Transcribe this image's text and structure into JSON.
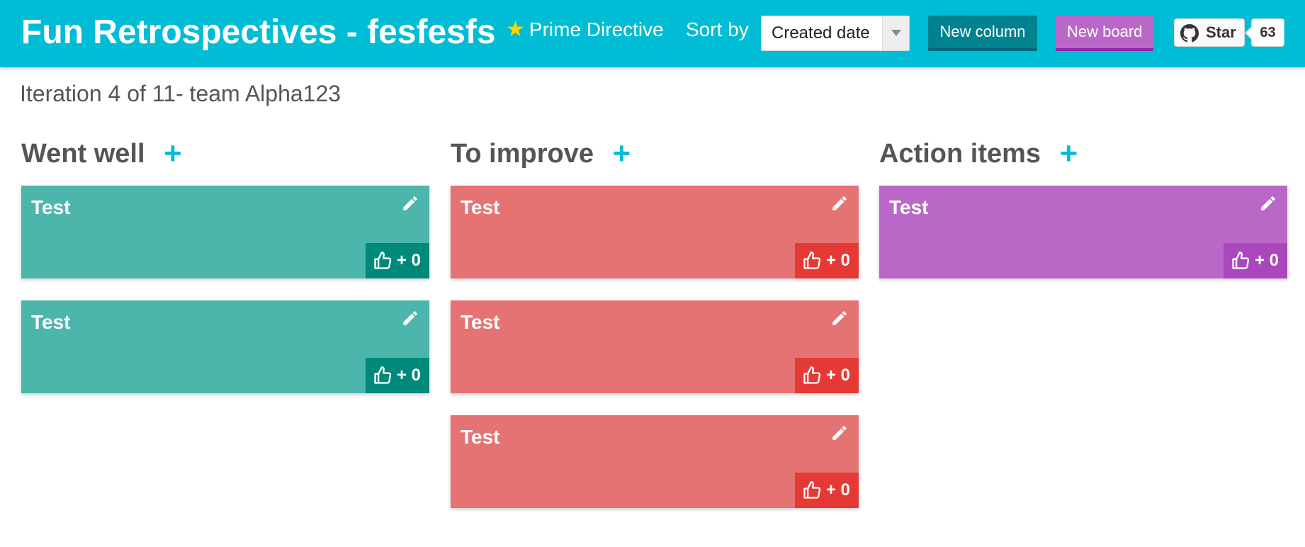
{
  "header": {
    "title": "Fun Retrospectives - fesfesfs",
    "prime_directive_label": "Prime Directive",
    "sort_label": "Sort by",
    "sort_value": "Created date",
    "new_column_label": "New column",
    "new_board_label": "New board",
    "github_star_label": "Star",
    "github_star_count": "63",
    "colors": {
      "bar": "#00bcd4",
      "new_column": "#00838f",
      "new_board": "#ba68c8",
      "star_icon": "#ffd600"
    }
  },
  "board": {
    "subtitle": "Iteration 4 of 11- team Alpha123"
  },
  "columns": [
    {
      "title": "Went well",
      "add_symbol": "+",
      "color": "#4db6ac",
      "vote_color": "#00897b",
      "cards": [
        {
          "text": "Test",
          "votes": "+ 0"
        },
        {
          "text": "Test",
          "votes": "+ 0"
        }
      ]
    },
    {
      "title": "To improve",
      "add_symbol": "+",
      "color": "#e57373",
      "vote_color": "#e53935",
      "cards": [
        {
          "text": "Test",
          "votes": "+ 0"
        },
        {
          "text": "Test",
          "votes": "+ 0"
        },
        {
          "text": "Test",
          "votes": "+ 0"
        }
      ]
    },
    {
      "title": "Action items",
      "add_symbol": "+",
      "color": "#ba68c8",
      "vote_color": "#ab47bc",
      "cards": [
        {
          "text": "Test",
          "votes": "+ 0"
        }
      ]
    }
  ],
  "icons": {
    "edit": "pencil-icon",
    "vote": "thumbs-up-icon",
    "github": "github-icon",
    "star": "star-icon"
  }
}
